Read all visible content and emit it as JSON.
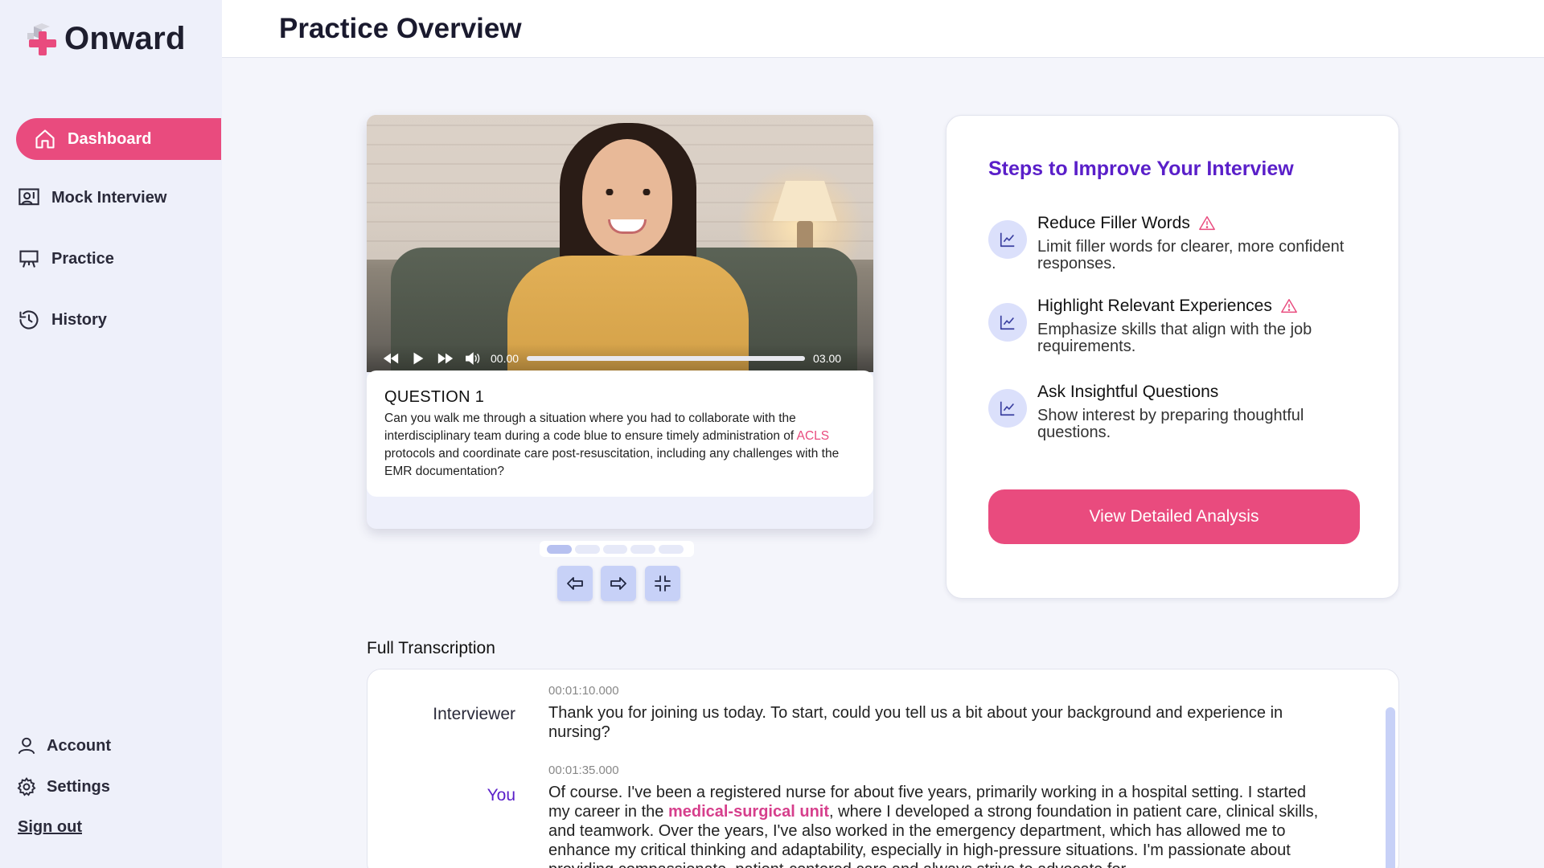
{
  "app": {
    "name": "Onward"
  },
  "header": {
    "title": "Practice Overview"
  },
  "sidebar": {
    "items": [
      {
        "label": "Dashboard",
        "icon": "home-icon",
        "active": true
      },
      {
        "label": "Mock Interview",
        "icon": "presentation-icon"
      },
      {
        "label": "Practice",
        "icon": "easel-icon"
      },
      {
        "label": "History",
        "icon": "history-icon"
      }
    ],
    "bottom": [
      {
        "label": "Account",
        "icon": "user-icon"
      },
      {
        "label": "Settings",
        "icon": "gear-icon"
      }
    ],
    "signout": "Sign out"
  },
  "video": {
    "current_time": "00.00",
    "duration": "03.00",
    "progress": 0.0
  },
  "question": {
    "title": "QUESTION 1",
    "text_before": "Can you walk me through a situation where you had to collaborate with the interdisciplinary team during a code blue to ensure timely administration of ",
    "highlight": "ACLS",
    "text_after": " protocols and coordinate care post-resuscitation, including any challenges with the EMR documentation?"
  },
  "slides": {
    "count": 5,
    "active_index": 0
  },
  "steps": {
    "title": "Steps to Improve Your Interview",
    "items": [
      {
        "heading": "Reduce Filler Words",
        "desc": "Limit filler words for clearer, more confident responses.",
        "warning": true
      },
      {
        "heading": "Highlight Relevant Experiences",
        "desc": "Emphasize skills that align with the job requirements.",
        "warning": true
      },
      {
        "heading": "Ask Insightful Questions",
        "desc": "Show interest by preparing thoughtful questions.",
        "warning": false
      }
    ],
    "button": "View Detailed Analysis"
  },
  "transcription": {
    "label": "Full Transcription",
    "entries": [
      {
        "speaker": "Interviewer",
        "timestamp": "00:01:10.000",
        "text": "Thank you for joining us today. To start, could you tell us a bit about your background and experience in nursing?"
      },
      {
        "speaker": "You",
        "timestamp": "00:01:35.000",
        "text_before": "Of course. I've been a registered nurse for about five years, primarily working in a hospital setting. I started my career in the ",
        "highlight": "medical-surgical unit",
        "text_after": ", where I developed a strong foundation in patient care, clinical skills, and teamwork. Over the years, I've also worked in the emergency department, which has allowed me to enhance my critical thinking and adaptability, especially in high-pressure situations. I'm passionate about providing compassionate, patient-centered care and always strive to advocate for"
      }
    ]
  },
  "colors": {
    "accent": "#e94b7e",
    "purple": "#5a1fc9",
    "sidebar_bg": "#eef0fa",
    "soft_blue": "#c7d1f7"
  }
}
